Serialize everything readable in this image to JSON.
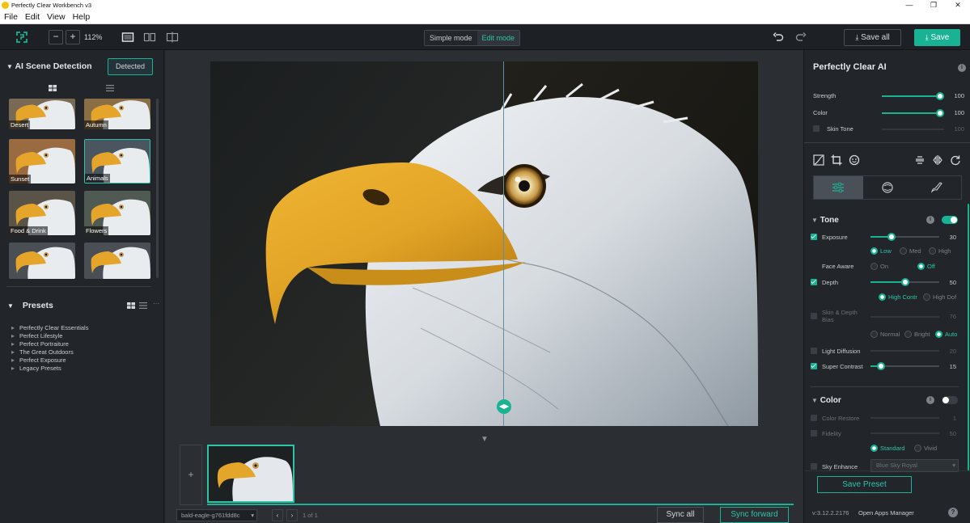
{
  "window": {
    "title": "Perfectly Clear Workbench v3",
    "controls": [
      "—",
      "❐",
      "✕"
    ]
  },
  "menu": [
    "File",
    "Edit",
    "View",
    "Help"
  ],
  "toolbar": {
    "zoom_minus": "−",
    "zoom_plus": "+",
    "zoom_level": "112%",
    "simple_mode": "Simple mode",
    "edit_mode": "Edit mode",
    "save_all": "Save all",
    "save": "Save",
    "accent": "#19b394"
  },
  "scene": {
    "title": "AI Scene Detection",
    "detected_label": "Detected",
    "thumbs": [
      {
        "label": "Desert"
      },
      {
        "label": "Autumn"
      },
      {
        "label": "Sunset"
      },
      {
        "label": "Animals"
      },
      {
        "label": "Food & Drink"
      },
      {
        "label": "Flowers"
      },
      {
        "label": ""
      },
      {
        "label": ""
      }
    ]
  },
  "presets": {
    "title": "Presets",
    "more": "···",
    "items": [
      "Perfectly Clear Essentials",
      "Perfect Lifestyle",
      "Perfect Portraiture",
      "The Great Outdoors",
      "Perfect Exposure",
      "Legacy Presets"
    ]
  },
  "filmstrip": {
    "add": "+",
    "file_name": "bald-eagle-g761fdd8c",
    "prev": "‹",
    "next": "›",
    "page_count": "1 of 1",
    "sync_all": "Sync all",
    "sync_forward": "Sync forward"
  },
  "right": {
    "title": "Perfectly Clear AI",
    "info": "i",
    "strength": {
      "label": "Strength",
      "value": "100",
      "level": 1.0
    },
    "color": {
      "label": "Color",
      "value": "100",
      "level": 1.0
    },
    "skin_tone": {
      "label": "Skin Tone",
      "value": "100",
      "level": 1.0
    },
    "tone": {
      "title": "Tone",
      "exposure": {
        "label": "Exposure",
        "value": "30",
        "level": 0.3
      },
      "exposure_opts": [
        "Low",
        "Med",
        "High"
      ],
      "face_aware": {
        "label": "Face Aware",
        "opts": [
          "On",
          "Off"
        ]
      },
      "depth": {
        "label": "Depth",
        "value": "50",
        "level": 0.5
      },
      "depth_opts": [
        "High Contr",
        "High Dof"
      ],
      "skin_depth": {
        "label1": "Skin & Depth",
        "label2": "Bias",
        "value": "76",
        "level": 0.76
      },
      "bias_opts": [
        "Normal",
        "Bright",
        "Auto"
      ],
      "light_diffusion": {
        "label": "Light Diffusion",
        "value": "20",
        "level": 0.2
      },
      "super_contrast": {
        "label": "Super Contrast",
        "value": "15",
        "level": 0.15
      }
    },
    "color_group": {
      "title": "Color",
      "color_restore": {
        "label": "Color Restore",
        "value": "1",
        "level": 0.01
      },
      "fidelity": {
        "label": "Fidelity",
        "value": "50",
        "level": 0.5
      },
      "fidelity_opts": [
        "Standard",
        "Vivid"
      ],
      "sky_enhance": {
        "label": "Sky Enhance",
        "option": "Blue Sky Royal"
      }
    },
    "save_preset": "Save Preset",
    "version": "v:3.12.2.2176",
    "apps_manager": "Open Apps Manager",
    "help": "?"
  }
}
